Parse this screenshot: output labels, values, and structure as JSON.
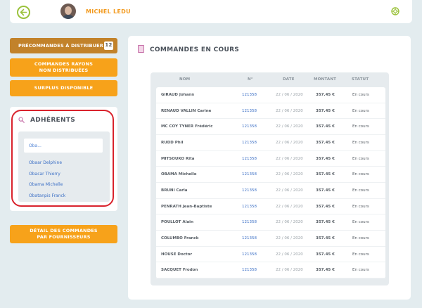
{
  "header": {
    "user_name": "MICHEL LEDU"
  },
  "sidebar": {
    "precommandes_label": "PRÉCOMMANDES À DISTRIBUER",
    "precommandes_count": "12",
    "rayons_line1": "COMMANDES RAYONS",
    "rayons_line2": "NON DISTRIBUÉES",
    "surplus_label": "SURPLUS DISPONIBLE",
    "detail_line1": "DÉTAIL DES COMMANDES",
    "detail_line2": "PAR FOURNISSEURS"
  },
  "adherents": {
    "title": "ADHÉRENTS",
    "search_value": "Oba...",
    "results": [
      "Obaar Delphine",
      "Obacar Thierry",
      "Obama Michelle",
      "Obatanpis Franck"
    ]
  },
  "main": {
    "title": "COMMANDES EN COURS",
    "columns": [
      "NOM",
      "N°",
      "DATE",
      "MONTANT",
      "STATUT"
    ],
    "rows": [
      {
        "nom": "GIRAUD Johann",
        "num": "121358",
        "date": "22 / 06 / 2020",
        "montant": "357.45 €",
        "statut": "En cours"
      },
      {
        "nom": "RENAUD VALLIN Carine",
        "num": "121358",
        "date": "22 / 06 / 2020",
        "montant": "357.45 €",
        "statut": "En cours"
      },
      {
        "nom": "MC COY TYNER Frédéric",
        "num": "121358",
        "date": "22 / 06 / 2020",
        "montant": "357.45 €",
        "statut": "En cours"
      },
      {
        "nom": "RUDD Phil",
        "num": "121358",
        "date": "22 / 06 / 2020",
        "montant": "357.45 €",
        "statut": "En cours"
      },
      {
        "nom": "MITSOUKO Rita",
        "num": "121358",
        "date": "22 / 06 / 2020",
        "montant": "357.45 €",
        "statut": "En cours"
      },
      {
        "nom": "OBAMA Michelle",
        "num": "121358",
        "date": "22 / 06 / 2020",
        "montant": "357.45 €",
        "statut": "En cours"
      },
      {
        "nom": "BRUNI Carla",
        "num": "121358",
        "date": "22 / 06 / 2020",
        "montant": "357.45 €",
        "statut": "En cours"
      },
      {
        "nom": "PENRATH Jean-Baptiste",
        "num": "121358",
        "date": "22 / 06 / 2020",
        "montant": "357.45 €",
        "statut": "En cours"
      },
      {
        "nom": "POULLOT Alain",
        "num": "121358",
        "date": "22 / 06 / 2020",
        "montant": "357.45 €",
        "statut": "En cours"
      },
      {
        "nom": "COLUMBO Franck",
        "num": "121358",
        "date": "22 / 06 / 2020",
        "montant": "357.45 €",
        "statut": "En cours"
      },
      {
        "nom": "HOUSE Doctor",
        "num": "121358",
        "date": "22 / 06 / 2020",
        "montant": "357.45 €",
        "statut": "En cours"
      },
      {
        "nom": "SACQUET Frodon",
        "num": "121358",
        "date": "22 / 06 / 2020",
        "montant": "357.45 €",
        "statut": "En cours"
      }
    ]
  },
  "colors": {
    "accent_orange": "#f7a21a",
    "accent_orange_dark": "#c2822a",
    "accent_green": "#9bc23c",
    "link_blue": "#3b6fc5",
    "highlight_red": "#d9232d"
  }
}
